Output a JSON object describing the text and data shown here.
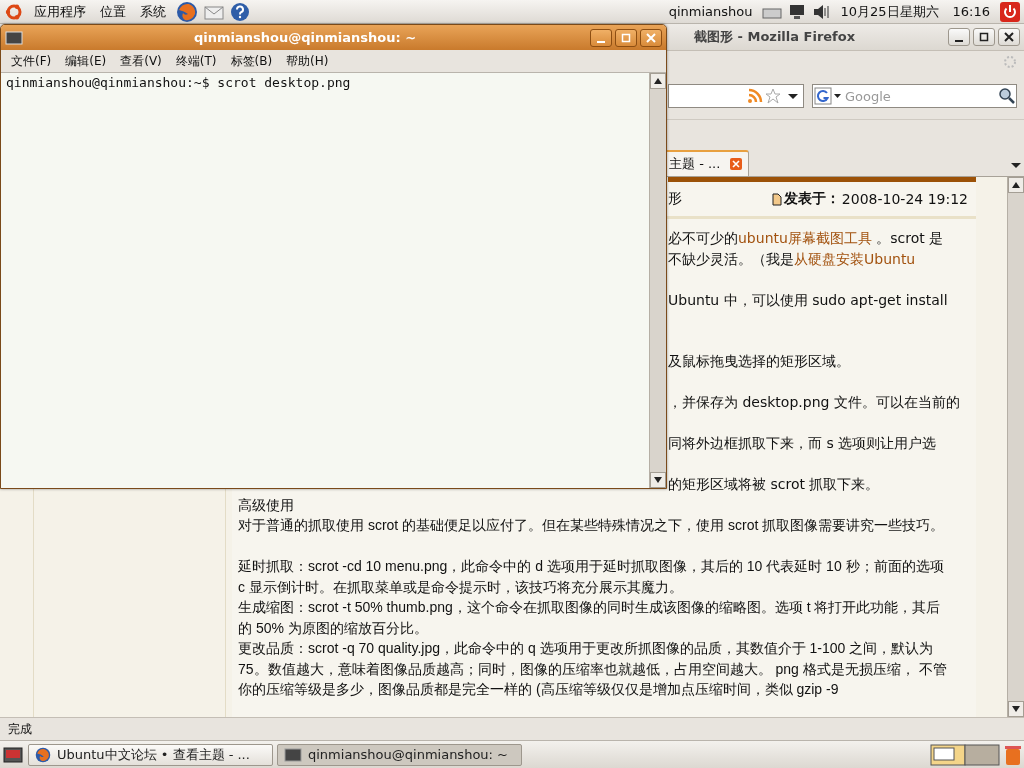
{
  "top_panel": {
    "menus": [
      "应用程序",
      "位置",
      "系统"
    ],
    "user": "qinmianshou",
    "date": "10月25日星期六",
    "time": "16:16"
  },
  "firefox": {
    "title": "截图形 - Mozilla Firefox",
    "search": {
      "placeholder": "Google"
    },
    "tabs": [
      {
        "label": "主题 - ...",
        "selected": true
      }
    ],
    "post": {
      "title_fragment": "形",
      "posted_label": "发表于：",
      "posted_time": "2008-10-24 19:12",
      "clipped_lines": [
        [
          {
            "kind": "text",
            "text": "必不可少的"
          },
          {
            "kind": "link",
            "text": "ubuntu屏幕截图工具"
          },
          {
            "kind": "text",
            "text": " 。scrot 是"
          }
        ],
        [
          {
            "kind": "text",
            "text": "不缺少灵活。（我是"
          },
          {
            "kind": "link",
            "text": "从硬盘安装Ubuntu"
          }
        ],
        [
          {
            "kind": "text",
            "text": "Ubuntu 中，可以使用 sudo apt-get install"
          }
        ],
        [
          {
            "kind": "text",
            "text": "及鼠标拖曳选择的矩形区域。"
          }
        ],
        [
          {
            "kind": "text",
            "text": "，并保存为 desktop.png 文件。可以在当前的"
          }
        ],
        [
          {
            "kind": "text",
            "text": "同将外边框抓取下来，而 s 选项则让用户选"
          }
        ],
        [
          {
            "kind": "text",
            "text": "的矩形区域将被 scrot 抓取下来。"
          }
        ]
      ],
      "heading": "高级使用",
      "paragraphs": [
        "对于普通的抓取使用 scrot 的基础便足以应付了。但在某些特殊情况之下，使用 scrot 抓取图像需要讲究一些技巧。",
        "延时抓取：scrot -cd 10 menu.png，此命令中的 d 选项用于延时抓取图像，其后的 10 代表延时 10 秒；前面的选项 c 显示倒计时。在抓取菜单或是命令提示时，该技巧将充分展示其魔力。",
        "生成缩图：scrot -t 50% thumb.png，这个命令在抓取图像的同时生成该图像的缩略图。选项 t 将打开此功能，其后的 50% 为原图的缩放百分比。",
        "更改品质：scrot -q 70 quality.jpg，此命令中的 q 选项用于更改所抓图像的品质，其数值介于 1-100 之间，默认为 75。数值越大，意味着图像品质越高；同时，图像的压缩率也就越低，占用空间越大。 png 格式是无损压缩， 不管你的压缩等级是多少，图像品质都是完全一样的 (高压缩等级仅仅是增加点压缩时间，类似 gzip -9"
      ]
    },
    "status": "完成"
  },
  "terminal": {
    "title": "qinmianshou@qinmianshou: ~",
    "menus": [
      "文件(F)",
      "编辑(E)",
      "查看(V)",
      "终端(T)",
      "标签(B)",
      "帮助(H)"
    ],
    "lines": [
      "qinmianshou@qinmianshou:~$ scrot desktop.png"
    ]
  },
  "taskbar": {
    "tasks": [
      {
        "kind": "browser",
        "label": "Ubuntu中文论坛 • 查看主题 - ...",
        "selected": false
      },
      {
        "kind": "terminal",
        "label": "qinmianshou@qinmianshou: ~",
        "selected": true
      }
    ]
  }
}
